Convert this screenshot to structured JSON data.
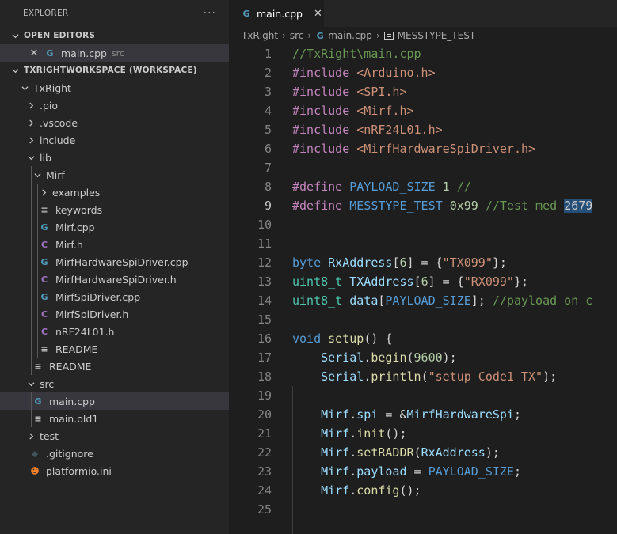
{
  "sidebar": {
    "title": "EXPLORER",
    "more": "···",
    "open_editors": {
      "header": "OPEN EDITORS",
      "items": [
        {
          "close": "✕",
          "icon": "G",
          "name": "main.cpp",
          "desc": "src"
        }
      ]
    },
    "workspace": {
      "header": "TXRIGHTWORKSPACE (WORKSPACE)",
      "tree": [
        {
          "label": "TxRight",
          "kind": "folder-open",
          "icon": ""
        },
        {
          "label": ".pio",
          "kind": "folder",
          "icon": ""
        },
        {
          "label": ".vscode",
          "kind": "folder",
          "icon": ""
        },
        {
          "label": "include",
          "kind": "folder",
          "icon": ""
        },
        {
          "label": "lib",
          "kind": "folder-open",
          "icon": ""
        },
        {
          "label": "Mirf",
          "kind": "folder-open",
          "icon": ""
        },
        {
          "label": "examples",
          "kind": "folder",
          "icon": ""
        },
        {
          "label": "keywords",
          "kind": "file",
          "icon": "≡"
        },
        {
          "label": "Mirf.cpp",
          "kind": "file",
          "icon": "G"
        },
        {
          "label": "Mirf.h",
          "kind": "file",
          "icon": "C"
        },
        {
          "label": "MirfHardwareSpiDriver.cpp",
          "kind": "file",
          "icon": "G"
        },
        {
          "label": "MirfHardwareSpiDriver.h",
          "kind": "file",
          "icon": "C"
        },
        {
          "label": "MirfSpiDriver.cpp",
          "kind": "file",
          "icon": "G"
        },
        {
          "label": "MirfSpiDriver.h",
          "kind": "file",
          "icon": "C"
        },
        {
          "label": "nRF24L01.h",
          "kind": "file",
          "icon": "C"
        },
        {
          "label": "README",
          "kind": "file",
          "icon": "≡"
        },
        {
          "label": "README",
          "kind": "file",
          "icon": "≡"
        },
        {
          "label": "src",
          "kind": "folder-open",
          "icon": ""
        },
        {
          "label": "main.cpp",
          "kind": "file",
          "icon": "G"
        },
        {
          "label": "main.old1",
          "kind": "file",
          "icon": "≡"
        },
        {
          "label": "test",
          "kind": "folder",
          "icon": ""
        },
        {
          "label": ".gitignore",
          "kind": "file",
          "icon": "◆"
        },
        {
          "label": "platformio.ini",
          "kind": "file",
          "icon": "☻"
        }
      ]
    }
  },
  "editor": {
    "tab": {
      "icon": "G",
      "label": "main.cpp",
      "close": "✕"
    },
    "breadcrumbs": {
      "items": [
        "TxRight",
        "src",
        "main.cpp",
        "MESSTYPE_TEST"
      ],
      "sep": "›"
    },
    "line_numbers": [
      "1",
      "2",
      "3",
      "4",
      "5",
      "6",
      "7",
      "8",
      "9",
      "10",
      "11",
      "12",
      "13",
      "14",
      "15",
      "16",
      "17",
      "18",
      "19",
      "20",
      "21",
      "22",
      "23",
      "24",
      "25"
    ],
    "lines": [
      [
        {
          "t": "//TxRight\\main.cpp",
          "c": "com"
        }
      ],
      [
        {
          "t": "#include ",
          "c": "pp"
        },
        {
          "t": "<Arduino.h>",
          "c": "str"
        }
      ],
      [
        {
          "t": "#include ",
          "c": "pp"
        },
        {
          "t": "<SPI.h>",
          "c": "str"
        }
      ],
      [
        {
          "t": "#include ",
          "c": "pp"
        },
        {
          "t": "<Mirf.h>",
          "c": "str"
        }
      ],
      [
        {
          "t": "#include ",
          "c": "pp"
        },
        {
          "t": "<nRF24L01.h>",
          "c": "str"
        }
      ],
      [
        {
          "t": "#include ",
          "c": "pp"
        },
        {
          "t": "<MirfHardwareSpiDriver.h>",
          "c": "str"
        }
      ],
      [],
      [
        {
          "t": "#define ",
          "c": "pp"
        },
        {
          "t": "PAYLOAD_SIZE",
          "c": "mac"
        },
        {
          "t": " ",
          "c": "plain"
        },
        {
          "t": "1",
          "c": "num"
        },
        {
          "t": " //",
          "c": "com"
        }
      ],
      [
        {
          "t": "#define ",
          "c": "pp"
        },
        {
          "t": "MESSTYPE_TEST",
          "c": "mac"
        },
        {
          "t": " ",
          "c": "plain"
        },
        {
          "t": "0x99",
          "c": "num"
        },
        {
          "t": " //Test med ",
          "c": "com"
        },
        {
          "t": "2679",
          "c": "hl"
        }
      ],
      [],
      [],
      [
        {
          "t": "byte",
          "c": "mac"
        },
        {
          "t": " ",
          "c": "plain"
        },
        {
          "t": "RxAddress",
          "c": "var"
        },
        {
          "t": "[",
          "c": "plain"
        },
        {
          "t": "6",
          "c": "num"
        },
        {
          "t": "] = {",
          "c": "plain"
        },
        {
          "t": "\"TX099\"",
          "c": "str"
        },
        {
          "t": "};",
          "c": "plain"
        }
      ],
      [
        {
          "t": "uint8_t",
          "c": "typ"
        },
        {
          "t": " ",
          "c": "plain"
        },
        {
          "t": "TXAddress",
          "c": "var"
        },
        {
          "t": "[",
          "c": "plain"
        },
        {
          "t": "6",
          "c": "num"
        },
        {
          "t": "] = {",
          "c": "plain"
        },
        {
          "t": "\"RX099\"",
          "c": "str"
        },
        {
          "t": "};",
          "c": "plain"
        }
      ],
      [
        {
          "t": "uint8_t",
          "c": "typ"
        },
        {
          "t": " ",
          "c": "plain"
        },
        {
          "t": "data",
          "c": "var"
        },
        {
          "t": "[",
          "c": "plain"
        },
        {
          "t": "PAYLOAD_SIZE",
          "c": "mac"
        },
        {
          "t": "]; ",
          "c": "plain"
        },
        {
          "t": "//payload on c",
          "c": "com"
        }
      ],
      [],
      [
        {
          "t": "void",
          "c": "mac"
        },
        {
          "t": " ",
          "c": "plain"
        },
        {
          "t": "setup",
          "c": "fn"
        },
        {
          "t": "() {",
          "c": "plain"
        }
      ],
      [
        {
          "t": "    ",
          "c": "plain"
        },
        {
          "t": "Serial",
          "c": "var"
        },
        {
          "t": ".",
          "c": "plain"
        },
        {
          "t": "begin",
          "c": "fn"
        },
        {
          "t": "(",
          "c": "plain"
        },
        {
          "t": "9600",
          "c": "num"
        },
        {
          "t": ");",
          "c": "plain"
        }
      ],
      [
        {
          "t": "    ",
          "c": "plain"
        },
        {
          "t": "Serial",
          "c": "var"
        },
        {
          "t": ".",
          "c": "plain"
        },
        {
          "t": "println",
          "c": "fn"
        },
        {
          "t": "(",
          "c": "plain"
        },
        {
          "t": "\"setup Code1 TX\"",
          "c": "str"
        },
        {
          "t": ");",
          "c": "plain"
        }
      ],
      [],
      [
        {
          "t": "    ",
          "c": "plain"
        },
        {
          "t": "Mirf",
          "c": "var"
        },
        {
          "t": ".",
          "c": "plain"
        },
        {
          "t": "spi",
          "c": "var"
        },
        {
          "t": " = &",
          "c": "plain"
        },
        {
          "t": "MirfHardwareSpi",
          "c": "var"
        },
        {
          "t": ";",
          "c": "plain"
        }
      ],
      [
        {
          "t": "    ",
          "c": "plain"
        },
        {
          "t": "Mirf",
          "c": "var"
        },
        {
          "t": ".",
          "c": "plain"
        },
        {
          "t": "init",
          "c": "fn"
        },
        {
          "t": "();",
          "c": "plain"
        }
      ],
      [
        {
          "t": "    ",
          "c": "plain"
        },
        {
          "t": "Mirf",
          "c": "var"
        },
        {
          "t": ".",
          "c": "plain"
        },
        {
          "t": "setRADDR",
          "c": "fn"
        },
        {
          "t": "(",
          "c": "plain"
        },
        {
          "t": "RxAddress",
          "c": "var"
        },
        {
          "t": ");",
          "c": "plain"
        }
      ],
      [
        {
          "t": "    ",
          "c": "plain"
        },
        {
          "t": "Mirf",
          "c": "var"
        },
        {
          "t": ".",
          "c": "plain"
        },
        {
          "t": "payload",
          "c": "var"
        },
        {
          "t": " = ",
          "c": "plain"
        },
        {
          "t": "PAYLOAD_SIZE",
          "c": "mac"
        },
        {
          "t": ";",
          "c": "plain"
        }
      ],
      [
        {
          "t": "    ",
          "c": "plain"
        },
        {
          "t": "Mirf",
          "c": "var"
        },
        {
          "t": ".",
          "c": "plain"
        },
        {
          "t": "config",
          "c": "fn"
        },
        {
          "t": "();",
          "c": "plain"
        }
      ],
      []
    ],
    "active_line": "9"
  },
  "colors": {
    "sidebar_bg": "#252526",
    "editor_bg": "#1e1e1e",
    "selection": "#37373d",
    "cpp_icon": "#519aba",
    "h_icon": "#a074c4",
    "comment": "#6a9955",
    "keyword": "#569cd6",
    "preprocessor": "#c586c0",
    "string": "#ce9178"
  }
}
